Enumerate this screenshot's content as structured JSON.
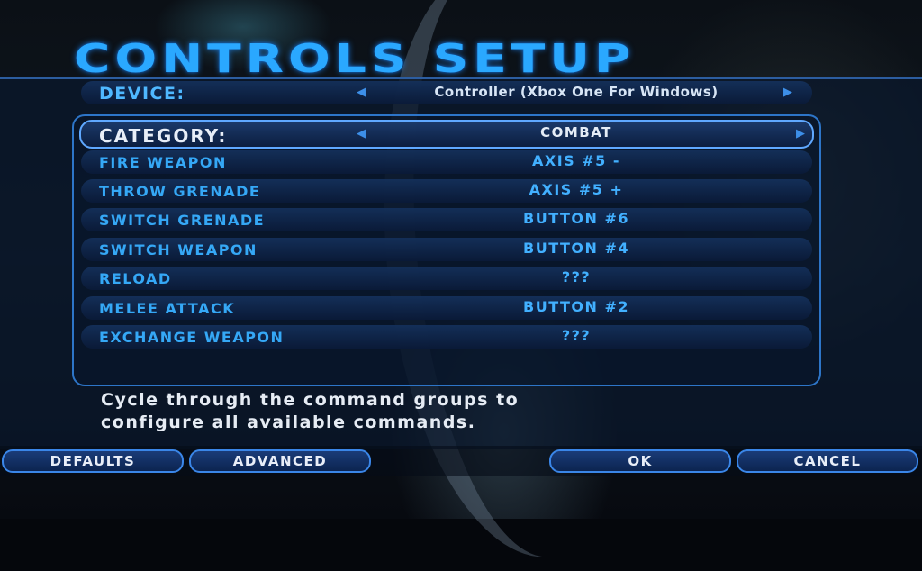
{
  "screen_title": "CONTROLS SETUP",
  "device": {
    "label": "DEVICE:",
    "value": "Controller (Xbox One For Windows)",
    "prev_arrow": "◀",
    "next_arrow": "▶"
  },
  "category": {
    "label": "CATEGORY:",
    "value": "COMBAT",
    "prev_arrow": "◀",
    "next_arrow": "▶"
  },
  "bindings": [
    {
      "action": "FIRE WEAPON",
      "key": "AXIS #5 -"
    },
    {
      "action": "THROW GRENADE",
      "key": "AXIS #5 +"
    },
    {
      "action": "SWITCH GRENADE",
      "key": "BUTTON #6"
    },
    {
      "action": "SWITCH WEAPON",
      "key": "BUTTON #4"
    },
    {
      "action": "RELOAD",
      "key": "???"
    },
    {
      "action": "MELEE ATTACK",
      "key": "BUTTON #2"
    },
    {
      "action": "EXCHANGE WEAPON",
      "key": "???"
    }
  ],
  "hint": {
    "line1": "Cycle through the command groups to",
    "line2": "configure all available commands."
  },
  "buttons": {
    "defaults": "DEFAULTS",
    "advanced": "ADVANCED",
    "ok": "OK",
    "cancel": "CANCEL"
  },
  "colors": {
    "accent": "#2aa8ff",
    "panel_border": "#2d75c8"
  }
}
